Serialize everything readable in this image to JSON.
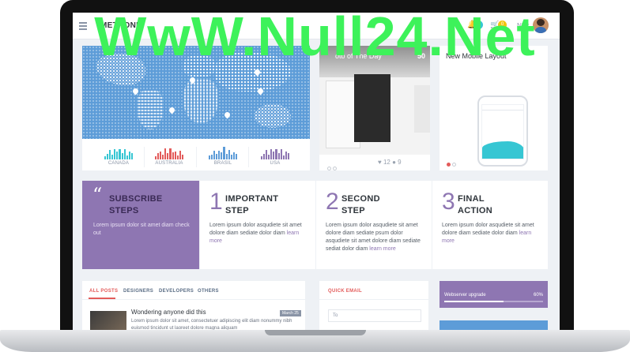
{
  "header": {
    "logo": "METRONIC",
    "notifications_count": "7",
    "cart_count": "0",
    "user_name": "Nick"
  },
  "map_widget": {
    "regions": [
      {
        "label": "CANADA",
        "color": "#36c6d3"
      },
      {
        "label": "AUSTRALIA",
        "color": "#e35b5a"
      },
      {
        "label": "BRASIL",
        "color": "#5d9cd8"
      },
      {
        "label": "USA",
        "color": "#8e76b2"
      }
    ]
  },
  "photo_card": {
    "title": "oto of The Day",
    "number": "50",
    "likes": "12",
    "comments": "9"
  },
  "mobile_card": {
    "title": "New Mobile Layout"
  },
  "steps": {
    "subscribe": {
      "title_line1": "SUBSCRIBE",
      "title_line2": "STEPS",
      "text": "Lorem ipsum dolor sit amet diam check out"
    },
    "items": [
      {
        "number": "1",
        "title_line1": "IMPORTANT",
        "title_line2": "STEP",
        "text": "Lorem ipsum dolor asqudiete sit amet dolore diam sediate dolor diam",
        "link": "learn more"
      },
      {
        "number": "2",
        "title_line1": "SECOND",
        "title_line2": "STEP",
        "text": "Lorem ipsum dolor asqudiete sit amet dolore diam sediate psum dolor asqudiete sit amet dolore diam sediate sediat dolor diam",
        "link": "learn more"
      },
      {
        "number": "3",
        "title_line1": "FINAL",
        "title_line2": "ACTION",
        "text": "Lorem ipsum dolor asqudiete sit amet dolore diam sediate dolor diam",
        "link": "learn more"
      }
    ]
  },
  "posts": {
    "tabs": [
      "ALL POSTS",
      "DESIGNERS",
      "DEVELOPERS",
      "OTHERS"
    ],
    "post": {
      "title": "Wondering anyone did this",
      "date": "March 25",
      "text": "Lorem ipsum dolor sit amet, consectetuer adipiscing elit diam nonummy nibh euismod tincidunt ut laoreet dolore magna aliquam"
    }
  },
  "quick_email": {
    "title": "QUICK EMAIL",
    "to_placeholder": "To"
  },
  "upgrade": {
    "label": "Webserver upgrade",
    "percent_text": "60%",
    "progress": 0.6
  },
  "watermark": "WwW.Null24.Net"
}
